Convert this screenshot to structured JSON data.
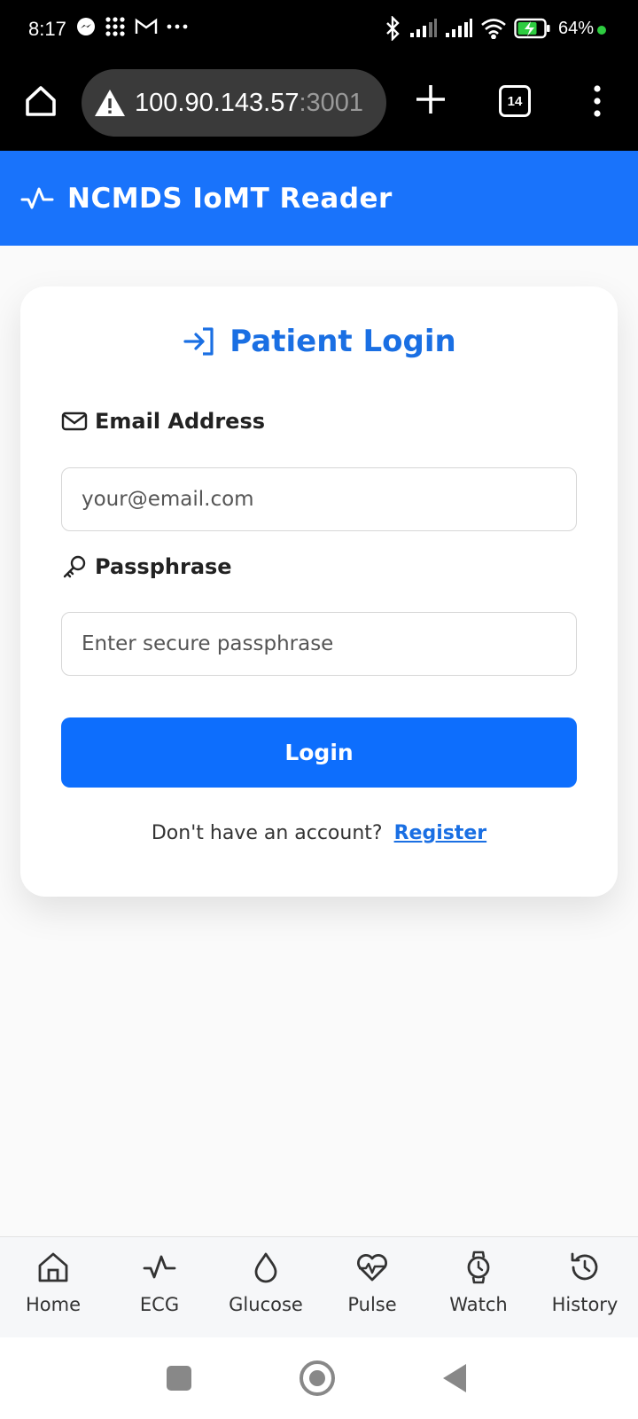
{
  "status_bar": {
    "time": "8:17",
    "battery": "64%",
    "notification_icons": [
      "messenger-icon",
      "apps-grid-icon",
      "gmail-icon",
      "more-dots-icon"
    ],
    "system_icons": [
      "bluetooth-icon",
      "signal-icon",
      "signal-icon",
      "wifi-icon",
      "battery-charging-icon"
    ]
  },
  "browser": {
    "url_host": "100.90.143.57",
    "url_port": ":3001",
    "tab_count": "14"
  },
  "app": {
    "title": "NCMDS IoMT Reader",
    "accent_color": "#1973fb"
  },
  "login": {
    "title": "Patient Login",
    "email_label": "Email Address",
    "email_placeholder": "your@email.com",
    "passphrase_label": "Passphrase",
    "passphrase_placeholder": "Enter secure passphrase",
    "button_label": "Login",
    "register_prompt": "Don't have an account?",
    "register_link": "Register"
  },
  "bottom_nav": {
    "items": [
      {
        "label": "Home",
        "icon": "home-icon"
      },
      {
        "label": "ECG",
        "icon": "activity-icon"
      },
      {
        "label": "Glucose",
        "icon": "droplet-icon"
      },
      {
        "label": "Pulse",
        "icon": "heart-pulse-icon"
      },
      {
        "label": "Watch",
        "icon": "watch-icon"
      },
      {
        "label": "History",
        "icon": "history-icon"
      }
    ]
  }
}
